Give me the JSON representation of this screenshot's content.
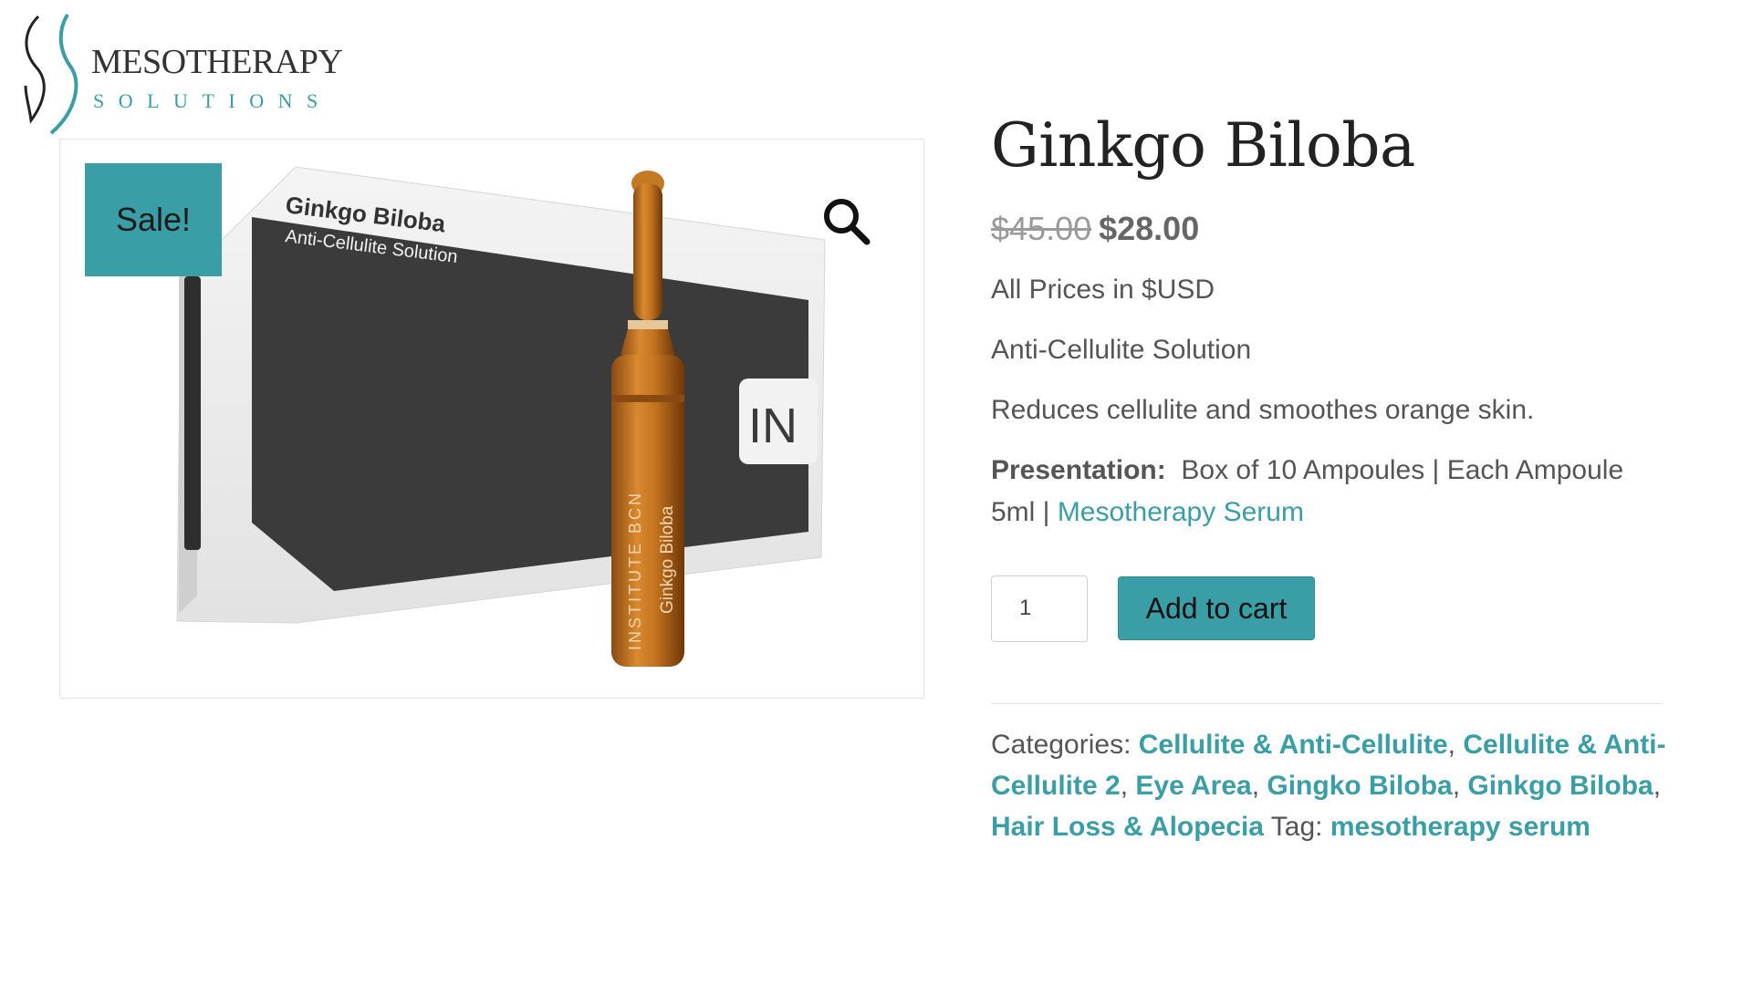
{
  "brand": {
    "name_line1": "MESOTHERAPY",
    "name_line2": "SOLUTIONS",
    "accent_color": "#3a9ea6"
  },
  "gallery": {
    "sale_badge": "Sale!",
    "zoom_icon": "magnifier-icon",
    "image": {
      "box_title": "Ginkgo Biloba",
      "box_subtitle": "Anti-Cellulite Solution",
      "ampoule_brand": "INSTITUTE BCN",
      "ampoule_label": "Ginkgo Biloba",
      "box_logo": "IN"
    }
  },
  "product": {
    "title": "Ginkgo Biloba",
    "price_regular": "$45.00",
    "price_sale": "$28.00",
    "prices_note": "All Prices in $USD",
    "subtitle": "Anti-Cellulite Solution",
    "description": "Reduces cellulite and smoothes orange skin.",
    "presentation_label": "Presentation:",
    "presentation_text": "Box of 10 Ampoules | Each Ampoule 5ml |",
    "presentation_link": "Mesotherapy Serum"
  },
  "cart": {
    "quantity": "1",
    "add_to_cart_label": "Add to cart"
  },
  "meta": {
    "categories_label": "Categories:",
    "categories": [
      "Cellulite & Anti-Cellulite",
      "Cellulite & Anti-Cellulite 2",
      "Eye Area",
      "Gingko Biloba",
      "Ginkgo Biloba",
      "Hair Loss & Alopecia"
    ],
    "tag_label": "Tag:",
    "tag": "mesotherapy serum"
  }
}
